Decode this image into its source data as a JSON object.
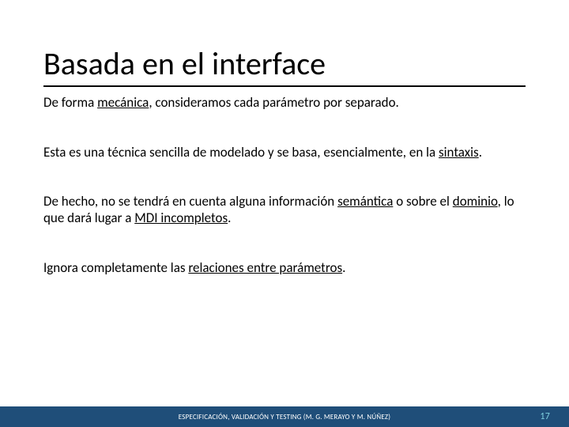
{
  "title": "Basada en el interface",
  "paragraphs": {
    "p1a": "De forma ",
    "p1u1": "mecánica",
    "p1b": ", consideramos cada parámetro por separado.",
    "p2a": "Esta es una técnica sencilla de modelado y se basa, esencialmente, en la ",
    "p2u1": "sintaxis",
    "p2b": ".",
    "p3a": "De hecho, no se tendrá en cuenta alguna información ",
    "p3u1": "semántica",
    "p3b": " o sobre el ",
    "p3u2": "dominio",
    "p3c": ", lo que dará lugar a ",
    "p3u3": "MDI incompletos",
    "p3d": ".",
    "p4a": "Ignora completamente las ",
    "p4u1": "relaciones entre parámetros",
    "p4b": "."
  },
  "footer": {
    "text": "ESPECIFICACIÓN, VALIDACIÓN Y TESTING (M. G. MERAYO Y M. NÚÑEZ)",
    "page": "17"
  }
}
